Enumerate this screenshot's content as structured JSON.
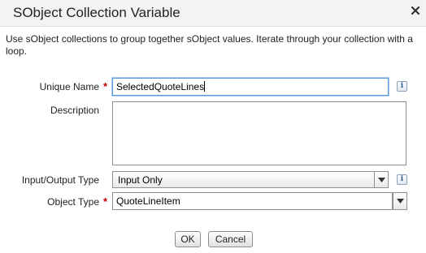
{
  "dialog": {
    "title": "SObject Collection Variable",
    "close_icon": "close-icon",
    "description": "Use sObject collections to group together sObject values. Iterate through your collection with a loop."
  },
  "form": {
    "unique_name": {
      "label": "Unique Name",
      "required_marker": "*",
      "value": "SelectedQuoteLines",
      "info_icon": "info-icon",
      "info_text": "i"
    },
    "description": {
      "label": "Description",
      "value": ""
    },
    "io_type": {
      "label": "Input/Output Type",
      "value": "Input Only",
      "info_icon": "info-icon",
      "info_text": "i"
    },
    "object_type": {
      "label": "Object Type",
      "required_marker": "*",
      "value": "QuoteLineItem"
    }
  },
  "buttons": {
    "ok": "OK",
    "cancel": "Cancel"
  },
  "colors": {
    "required": "#c00000",
    "focus_border": "#5b9bd5",
    "titlebar_bg": "#f3f3f3"
  }
}
